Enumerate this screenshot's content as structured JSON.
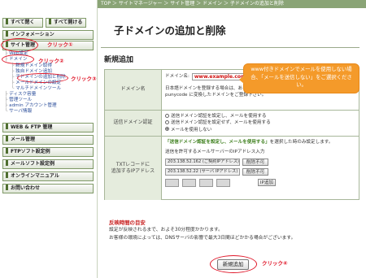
{
  "breadcrumb": "TOP ＞ サイトマネージャー ＞ サイト管理 ＞ ドメイン ＞ 子ドメインの追加と削除",
  "sidebar": {
    "close_all": "すべて閉く",
    "open_all": "すべて開ける",
    "info": "インフォメーション",
    "site_admin": "サイト管理",
    "tree": [
      "Web設定",
      "ドメイン",
      "新規ドメイン取得",
      "独自ドメイン追加",
      "子ドメインの追加と削除",
      "メールドメインの設定",
      "マルチドメインツール",
      "ディスク容量",
      "管理ツール",
      "admin アカウント管理",
      "サーバ情報"
    ],
    "menus": [
      "WEB & FTP 管理",
      "メール管理",
      "FTPソフト設定例",
      "メールソフト設定例",
      "オンラインマニュアル",
      "お問い合わせ"
    ]
  },
  "annotations": {
    "click1": "クリック①",
    "click2": "クリック②",
    "click3": "クリック③",
    "click4": "クリック④"
  },
  "page": {
    "title": "子ドメインの追加と削除",
    "subtitle": "新規追加"
  },
  "tooltip": "www付きドメインでメールを使用しない場合、「メールを送信しない」をご選択ください。",
  "form": {
    "domain_label": "ドメイン名",
    "domain_prefix": "ドメイン名:",
    "domain_value": "www.example.com",
    "domain_desc1": "日本語ドメインを登録する場合は、あらかじめ http://punycode.jp/ 等で",
    "domain_desc2": "punycode に変換したドメインをご登録下さい。",
    "mail_label": "送信ドメイン認証",
    "mail_opt1": "送信ドメイン認証を設定し、メールを使用する",
    "mail_opt2": "送信ドメイン認証を設定せず、メールを使用する",
    "mail_opt3": "メールを使用しない",
    "txt_label_1": "TXTレコードに",
    "txt_label_2": "追加するIPアドレス",
    "txt_note_em": "「送信ドメイン認証を設定し、メールを使用する」",
    "txt_note_rest": "を選択した時のみ設定します。",
    "txt_desc": "送信を許可するメールサーバーのIPアドレス入力",
    "ip1": "203.138.52.162 (ご契約IPアドレス)",
    "ip2": "203.138.52.22 (サーバ IPアドレス)",
    "delete": "削除不可",
    "ip_add": "IP追加"
  },
  "notes": {
    "heading": "反映時間の目安",
    "line1": "設定が反映されるまで、およそ30分程度かかります。",
    "line2": "お客様の環境によっては、DNSサーバの影響で最大3日間ほどかかる場合がございます。"
  },
  "submit": "新規追加"
}
